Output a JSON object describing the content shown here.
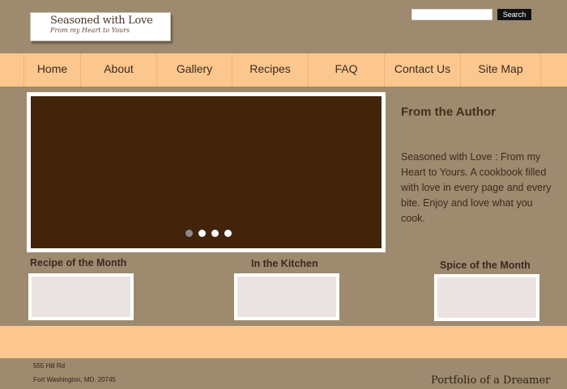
{
  "logo": {
    "title": "Seasoned with Love",
    "subtitle": "From my Heart to Yours"
  },
  "search": {
    "value": "",
    "placeholder": "",
    "button_label": "Search"
  },
  "nav": {
    "items": [
      {
        "label": "Home"
      },
      {
        "label": "About"
      },
      {
        "label": "Gallery"
      },
      {
        "label": "Recipes"
      },
      {
        "label": "FAQ"
      },
      {
        "label": "Contact Us"
      },
      {
        "label": "Site Map"
      }
    ]
  },
  "slideshow": {
    "slide_count": 4,
    "active_index": 0
  },
  "author": {
    "title": "From the Author",
    "text": "Seasoned with Love : From my Heart to Yours.  A cookbook filled with love in every page and every bite.  Enjoy and love what you cook."
  },
  "sections": [
    {
      "title": "Recipe of the Month"
    },
    {
      "title": "In the Kitchen"
    },
    {
      "title": "Spice of the Month"
    }
  ],
  "footer": {
    "address_line1": "555 Hill Rd",
    "address_line2": "Fort Washington, MD. 20745",
    "portfolio": "Portfolio of a Dreamer"
  },
  "colors": {
    "background": "#9e8a6e",
    "nav_band": "#fbc78e",
    "hero_fill": "#42240a",
    "thumb_fill": "#ece3e3"
  }
}
